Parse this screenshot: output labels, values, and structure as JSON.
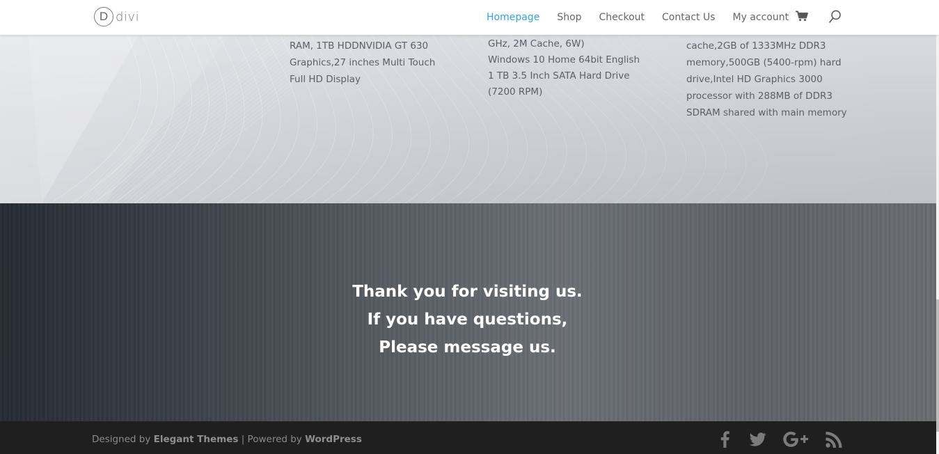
{
  "header": {
    "logo_letter": "D",
    "logo_text": "divi",
    "nav": [
      {
        "label": "Homepage",
        "active": true
      },
      {
        "label": "Shop",
        "active": false
      },
      {
        "label": "Checkout",
        "active": false
      },
      {
        "label": "Contact Us",
        "active": false
      },
      {
        "label": "My account",
        "active": false
      }
    ],
    "cart_icon": "shopping-cart-icon",
    "search_icon": "search-icon",
    "accent_color": "#2ea3f2"
  },
  "products": [
    {
      "lines": [
        "RAM, 1TB HDDNVIDIA GT 630",
        "Graphics,27 inches Multi Touch",
        "Full HD Display"
      ]
    },
    {
      "lines": [
        "GHz, 2M Cache, 6W)",
        "Windows 10 Home 64bit English",
        "1 TB 3.5 Inch SATA Hard Drive",
        "(7200 RPM)"
      ]
    },
    {
      "lines": [
        "cache,2GB of 1333MHz DDR3",
        "memory,500GB (5400-rpm) hard",
        "drive,Intel HD Graphics 3000",
        "processor with 288MB of DDR3",
        "SDRAM shared with main memory"
      ]
    }
  ],
  "thanks": {
    "lines": [
      "Thank you for visiting us.",
      "If you have questions,",
      "Please message us."
    ]
  },
  "footer": {
    "designed_by": "Designed by ",
    "designer": "Elegant Themes",
    "separator": " | Powered by ",
    "platform": "WordPress",
    "social": [
      "facebook-icon",
      "twitter-icon",
      "google-plus-icon",
      "rss-icon"
    ]
  }
}
